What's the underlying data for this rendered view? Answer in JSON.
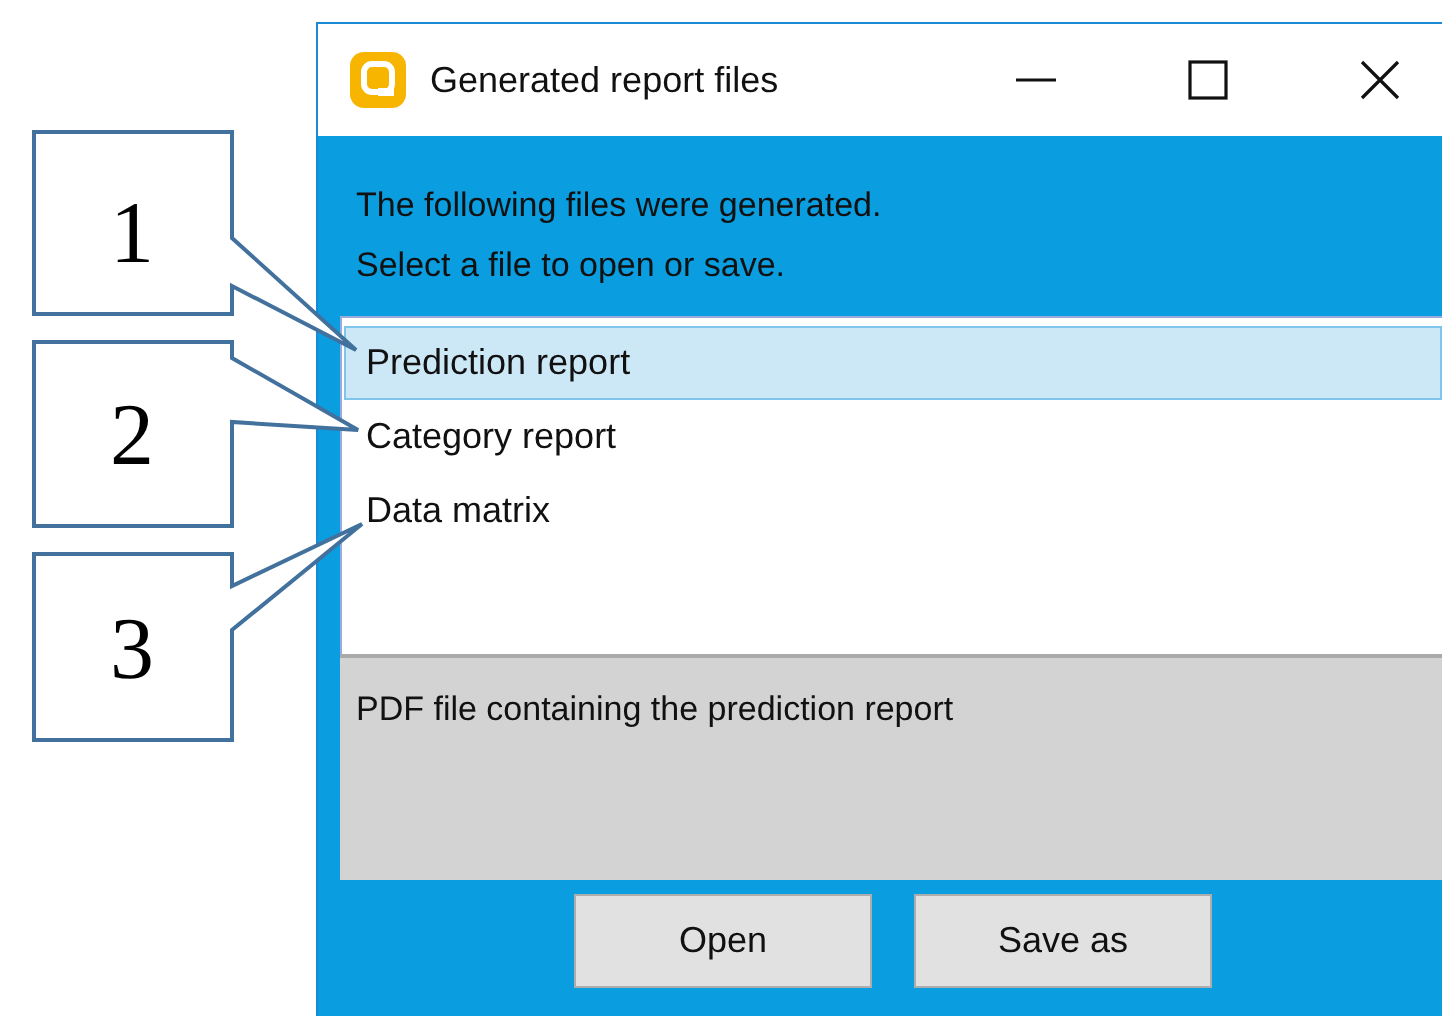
{
  "window": {
    "title": "Generated report files"
  },
  "intro": [
    "The following files were generated.",
    "Select a file to open or save."
  ],
  "files": [
    {
      "label": "Prediction report",
      "selected": true
    },
    {
      "label": "Category report",
      "selected": false
    },
    {
      "label": "Data matrix",
      "selected": false
    }
  ],
  "description": "PDF file containing the prediction report",
  "buttons": [
    "Open",
    "Save as"
  ],
  "callouts": [
    "1",
    "2",
    "3"
  ]
}
